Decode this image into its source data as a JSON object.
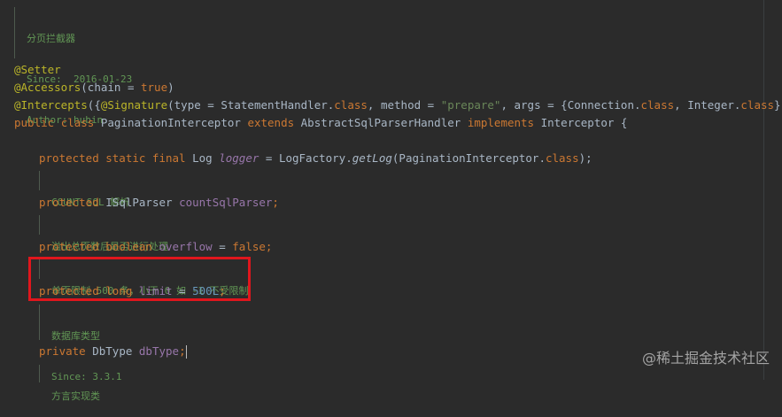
{
  "doc_top": {
    "line1": "分页拦截器",
    "line2": "Since:  2016-01-23",
    "line3": "Author: hubin"
  },
  "code": {
    "setter": "@Setter",
    "accessors_ann": "@Accessors",
    "accessors_args": "(chain = ",
    "accessors_true": "true",
    "accessors_close": ")",
    "intercepts_ann": "@Intercepts",
    "intercepts_open": "({",
    "signature_ann": "@Signature",
    "sig_type": "(type = StatementHandler.",
    "sig_class1": "class",
    "sig_method": ", method = ",
    "sig_prepare": "\"prepare\"",
    "sig_args": ", args = {Connection.",
    "sig_class2": "class",
    "sig_integer": ", Integer.",
    "sig_class3": "class",
    "sig_close": "})})",
    "class_public": "public",
    "class_kw": "class",
    "class_name": "PaginationInterceptor",
    "class_extends": "extends",
    "class_parent": "AbstractSqlParserHandler",
    "class_implements": "implements",
    "class_iface": "Interceptor {",
    "log_mods": "protected static final",
    "log_type": "Log",
    "log_name": "logger",
    "log_eq": " = LogFactory.",
    "log_method": "getLog",
    "log_arg": "(PaginationInterceptor.",
    "log_class": "class",
    "log_end": ");",
    "doc_count": "COUNT SQL 解析",
    "parser_mod": "protected",
    "parser_type": "ISqlParser",
    "parser_name": "countSqlParser",
    "parser_end": ";",
    "doc_overflow": "溢出总页数后是否进行处理",
    "overflow_mods": "protected boolean",
    "overflow_name": "overflow",
    "overflow_eq": " = ",
    "overflow_val": "false",
    "overflow_end": ";",
    "doc_limit": "单页限制 500 条，小于 0 如 -1 不受限制",
    "limit_mods": "protected long",
    "limit_name": "limit",
    "limit_eq": " = ",
    "limit_val": "500L",
    "limit_end": ";",
    "doc_db1": "数据库类型",
    "doc_db2": "Since: 3.3.1",
    "db_mod": "private",
    "db_type": "DbType",
    "db_name": "dbType",
    "db_end": ";",
    "doc_dialect": "方言实现类"
  },
  "watermark": "@稀土掘金技术社区"
}
